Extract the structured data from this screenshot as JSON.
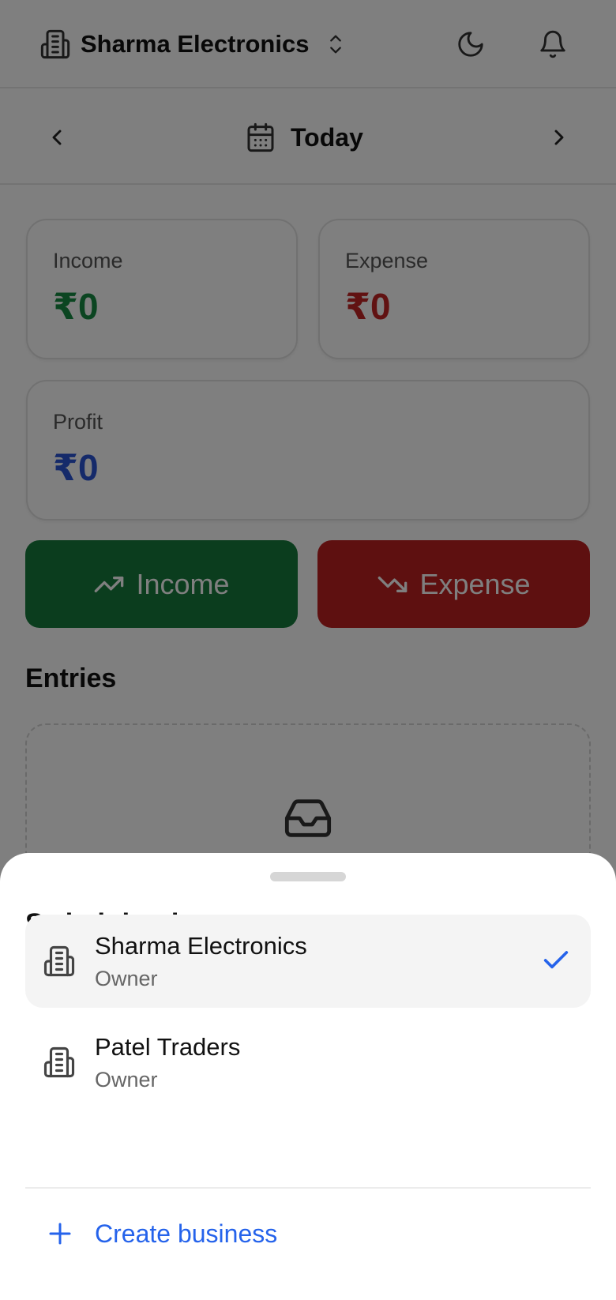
{
  "header": {
    "business_name": "Sharma Electronics",
    "icons": [
      "building-icon",
      "chevron-up-down-icon",
      "moon-icon",
      "bell-icon"
    ]
  },
  "date_nav": {
    "label": "Today"
  },
  "summary": {
    "income": {
      "label": "Income",
      "value": "₹0",
      "color": "#178a43"
    },
    "expense": {
      "label": "Expense",
      "value": "₹0",
      "color": "#c22525"
    },
    "profit": {
      "label": "Profit",
      "value": "₹0",
      "color": "#2a55d4"
    }
  },
  "actions": {
    "income_label": "Income",
    "expense_label": "Expense",
    "income_color": "#167a3c",
    "expense_color": "#bd2020"
  },
  "entries": {
    "title": "Entries"
  },
  "sheet": {
    "title": "Switch business",
    "businesses": [
      {
        "name": "Sharma Electronics",
        "role": "Owner",
        "selected": true
      },
      {
        "name": "Patel Traders",
        "role": "Owner",
        "selected": false
      }
    ],
    "create_label": "Create business",
    "accent": "#2563eb"
  }
}
